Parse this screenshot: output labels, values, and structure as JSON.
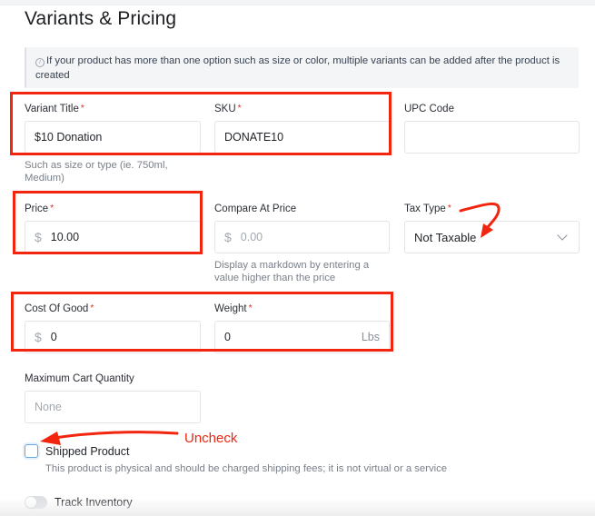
{
  "section": {
    "title": "Variants & Pricing",
    "notice": "If your product has more than one option such as size or color, multiple variants can be added after the product is created"
  },
  "fields": {
    "variant_title": {
      "label": "Variant Title",
      "required_mark": "*",
      "value": "$10 Donation",
      "help": "Such as size or type (ie. 750ml, Medium)"
    },
    "sku": {
      "label": "SKU",
      "required_mark": "*",
      "value": "DONATE10"
    },
    "upc": {
      "label": "UPC Code",
      "value": ""
    },
    "price": {
      "label": "Price",
      "required_mark": "*",
      "prefix": "$",
      "value": "10.00"
    },
    "compare_at_price": {
      "label": "Compare At Price",
      "prefix": "$",
      "placeholder": "0.00",
      "help": "Display a markdown by entering a value higher than the price"
    },
    "tax_type": {
      "label": "Tax Type",
      "required_mark": "*",
      "selected": "Not Taxable"
    },
    "cost_of_good": {
      "label": "Cost Of Good",
      "required_mark": "*",
      "prefix": "$",
      "value": "0"
    },
    "weight": {
      "label": "Weight",
      "required_mark": "*",
      "value": "0",
      "unit": "Lbs"
    },
    "max_cart_quantity": {
      "label": "Maximum Cart Quantity",
      "placeholder": "None"
    }
  },
  "shipped_product": {
    "label": "Shipped Product",
    "checked": false,
    "help": "This product is physical and should be charged shipping fees; it is not virtual or a service"
  },
  "track_inventory": {
    "label": "Track Inventory",
    "enabled": false
  },
  "annotations": {
    "uncheck_text": "Uncheck",
    "color": "#f2250f"
  }
}
